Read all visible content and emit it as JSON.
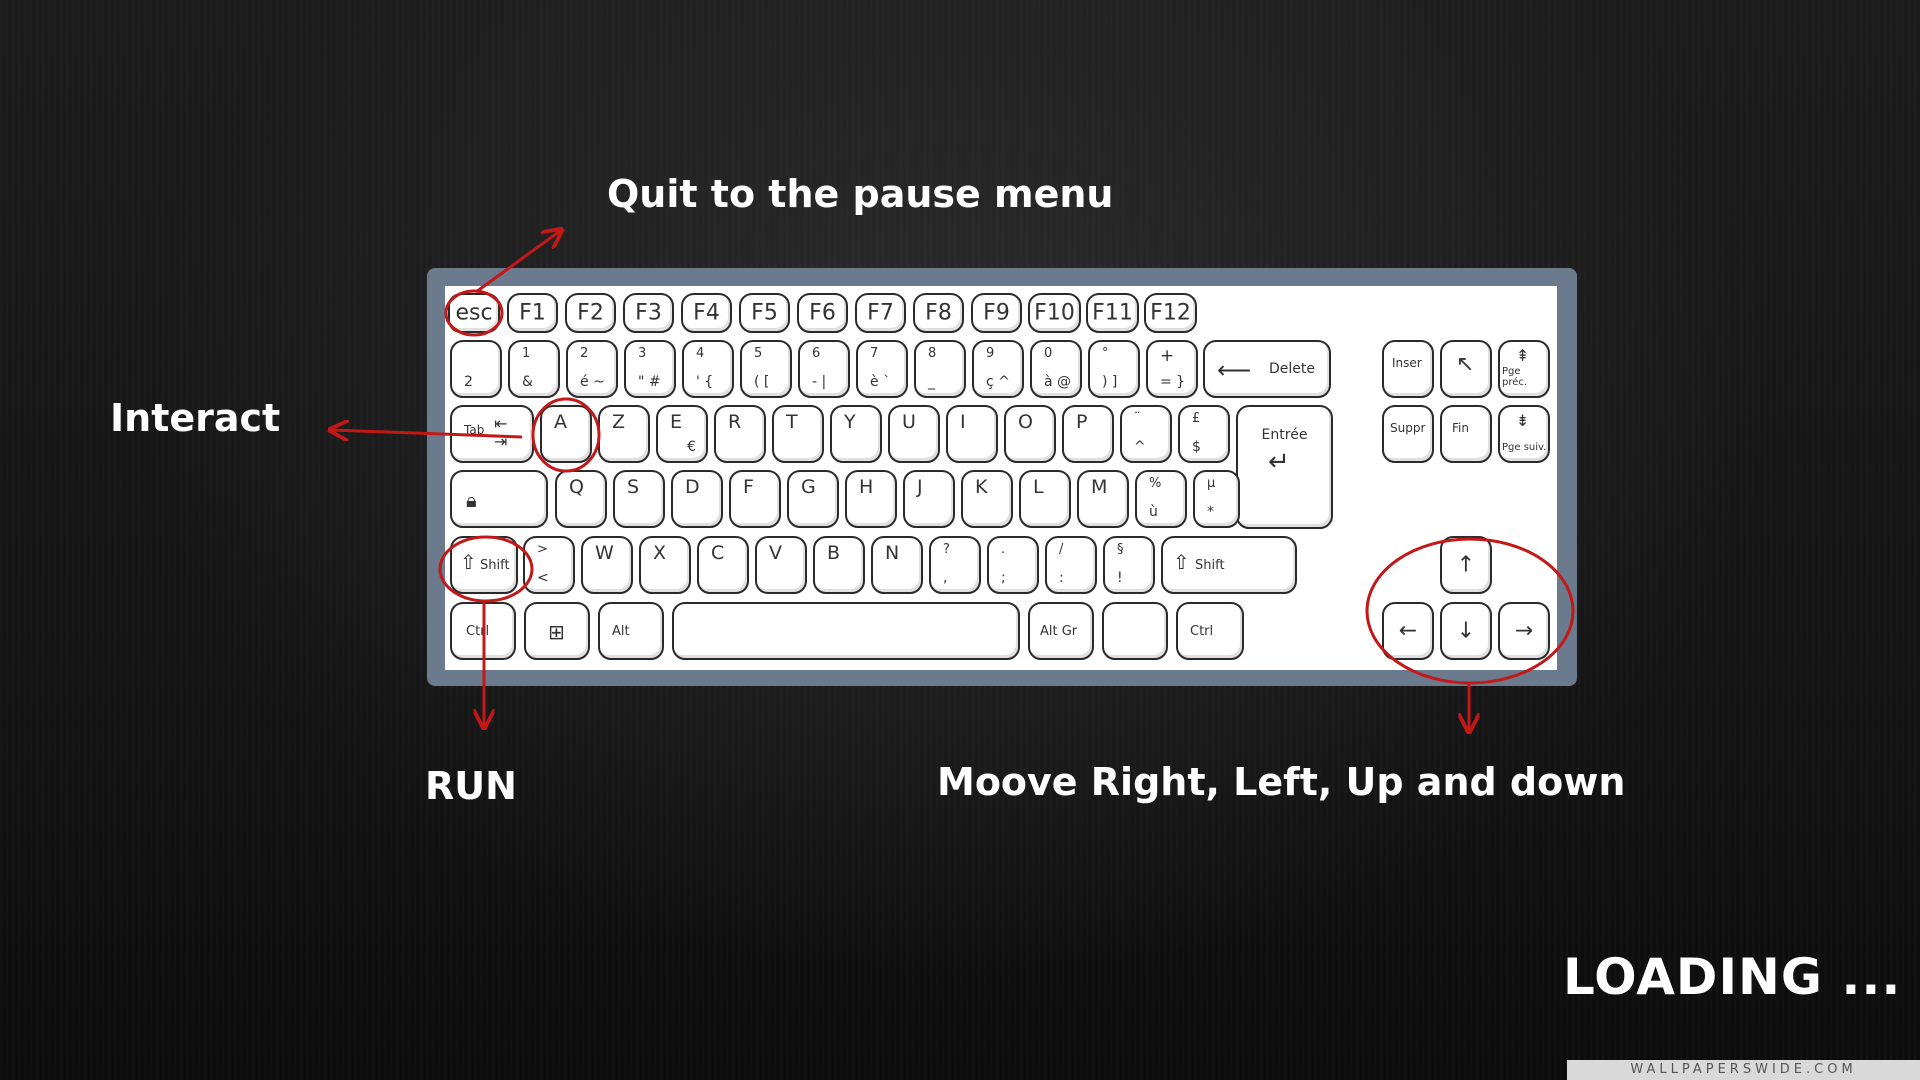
{
  "annotations": {
    "quit": "Quit to the pause menu",
    "interact": "Interact",
    "run": "RUN",
    "move": "Moove Right, Left, Up and down"
  },
  "status": {
    "loading": "LOADING ..."
  },
  "watermark": "WALLPAPERSWIDE.COM",
  "colors": {
    "annotation": "#c21818",
    "frame": "#6b7a8c",
    "text": "#ffffff"
  },
  "keyboard": {
    "function_row": [
      "esc",
      "F1",
      "F2",
      "F3",
      "F4",
      "F5",
      "F6",
      "F7",
      "F8",
      "F9",
      "F10",
      "F11",
      "F12"
    ],
    "number_row": [
      {
        "top": "",
        "bottom": "2"
      },
      {
        "top": "1",
        "bottom": "&"
      },
      {
        "top": "2",
        "bottom": "é ~"
      },
      {
        "top": "3",
        "bottom": "\" #"
      },
      {
        "top": "4",
        "bottom": "' {"
      },
      {
        "top": "5",
        "bottom": "( ["
      },
      {
        "top": "6",
        "bottom": "- |"
      },
      {
        "top": "7",
        "bottom": "è `"
      },
      {
        "top": "8",
        "bottom": "_"
      },
      {
        "top": "9",
        "bottom": "ç ^"
      },
      {
        "top": "0",
        "bottom": "à @"
      },
      {
        "top": "°",
        "bottom": ") ]"
      },
      {
        "top": "+",
        "bottom": "= }"
      }
    ],
    "delete": "Delete",
    "tab": "Tab",
    "row_a": [
      "A",
      "Z",
      "E",
      "R",
      "T",
      "Y",
      "U",
      "I",
      "O",
      "P"
    ],
    "euro": "€",
    "caret_key": {
      "top": "¨",
      "bottom": "^"
    },
    "pound_key": {
      "top": "£",
      "bottom": "$"
    },
    "enter": "Entrée",
    "row_q": [
      "Q",
      "S",
      "D",
      "F",
      "G",
      "H",
      "J",
      "K",
      "L",
      "M"
    ],
    "percent_key": {
      "top": "%",
      "bottom": "ù"
    },
    "mu_key": {
      "top": "µ",
      "bottom": "*"
    },
    "shift": "Shift",
    "angle_key": {
      "top": ">",
      "bottom": "<"
    },
    "row_w": [
      "W",
      "X",
      "C",
      "V",
      "B",
      "N"
    ],
    "question_key": {
      "top": "?",
      "bottom": ","
    },
    "period_key": {
      "top": ".",
      "bottom": ";"
    },
    "slash_key": {
      "top": "/",
      "bottom": ":"
    },
    "section_key": {
      "top": "§",
      "bottom": "!"
    },
    "ctrl": "Ctrl",
    "alt": "Alt",
    "alt_gr": "Alt Gr",
    "ctrl_right": "Ctrl",
    "inser": "Inser",
    "pg_prec": "Pge préc.",
    "suppr": "Suppr",
    "fin": "Fin",
    "pg_suiv": "Pge suiv."
  }
}
